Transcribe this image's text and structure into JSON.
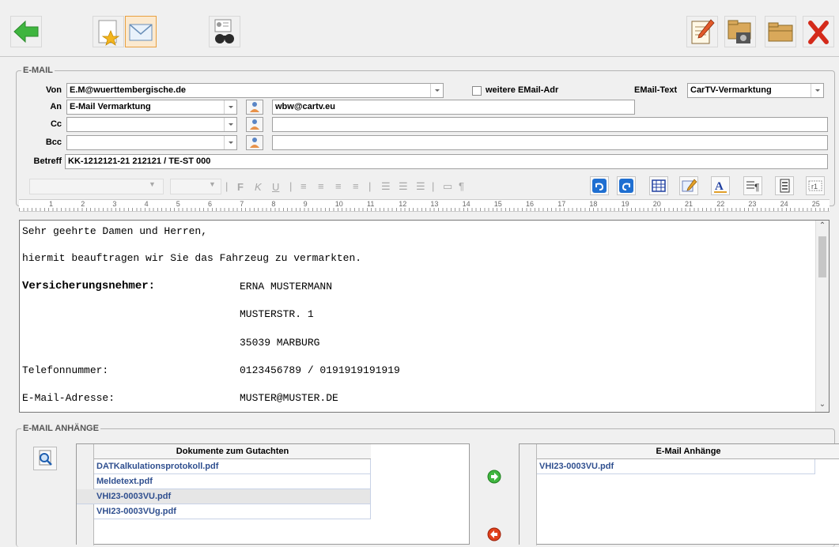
{
  "email": {
    "group_title": "E-MAIL",
    "von_label": "Von",
    "von_value": "E.M@wuerttembergische.de",
    "weitere_label": "weitere EMail-Adr",
    "emailtext_label": "EMail-Text",
    "emailtext_value": "CarTV-Vermarktung",
    "an_label": "An",
    "an_value": "E-Mail Vermarktung",
    "an_address": "wbw@cartv.eu",
    "cc_label": "Cc",
    "cc_value": "",
    "cc_address": "",
    "bcc_label": "Bcc",
    "bcc_value": "",
    "bcc_address": "",
    "betreff_label": "Betreff",
    "betreff_value": "KK-1212121-21 212121 / TE-ST 000"
  },
  "format_bar": {
    "bold": "F",
    "italic": "K",
    "underline": "U",
    "pilcrow": "¶"
  },
  "ruler_numbers": [
    "1",
    "2",
    "3",
    "4",
    "5",
    "6",
    "7",
    "8",
    "9",
    "10",
    "11",
    "12",
    "13",
    "14",
    "15",
    "16",
    "17",
    "18",
    "19",
    "20",
    "21",
    "22",
    "23",
    "24",
    "25"
  ],
  "editor": {
    "greeting": "Sehr geehrte Damen und Herren,",
    "intro": "hiermit beauftragen wir Sie das Fahrzeug zu vermarkten.",
    "vn_label": "Versicherungsnehmer:",
    "vn_name": "ERNA MUSTERMANN",
    "vn_street": "MUSTERSTR. 1",
    "vn_city": "35039 MARBURG",
    "tel_label": "Telefonnummer:",
    "tel_value": "0123456789 / 0191919191919",
    "mail_label": "E-Mail-Adresse:",
    "mail_value": "MUSTER@MUSTER.DE"
  },
  "attachments": {
    "group_title": "E-MAIL ANHÄNGE",
    "docs_header": "Dokumente zum Gutachten",
    "docs": [
      "DATKalkulationsprotokoll.pdf",
      "Meldetext.pdf",
      "VHI23-0003VU.pdf",
      "VHI23-0003VUg.pdf"
    ],
    "attached_header": "E-Mail Anhänge",
    "attached": [
      "VHI23-0003VU.pdf"
    ]
  },
  "colors": {
    "accent_green": "#3fb53f",
    "close_red": "#d42a1a",
    "link_blue": "#2f4f8f"
  }
}
